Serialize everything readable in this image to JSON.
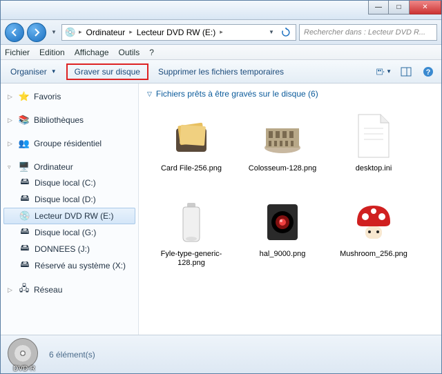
{
  "window": {
    "minimize": "—",
    "maximize": "□",
    "close": "✕"
  },
  "nav": {
    "breadcrumbs": [
      "Ordinateur",
      "Lecteur DVD RW (E:)"
    ],
    "search_placeholder": "Rechercher dans : Lecteur DVD R..."
  },
  "menu": {
    "file": "Fichier",
    "edit": "Edition",
    "view": "Affichage",
    "tools": "Outils",
    "help": "?"
  },
  "toolbar": {
    "organize": "Organiser",
    "burn": "Graver sur disque",
    "delete_temp": "Supprimer les fichiers temporaires"
  },
  "sidebar": {
    "favorites": "Favoris",
    "libraries": "Bibliothèques",
    "homegroup": "Groupe résidentiel",
    "computer": "Ordinateur",
    "drives": [
      "Disque local (C:)",
      "Disque local (D:)",
      "Lecteur DVD RW (E:)",
      "Disque local (G:)",
      "DONNEES (J:)",
      "Réservé au système (X:)"
    ],
    "network": "Réseau"
  },
  "content": {
    "header": "Fichiers prêts à être gravés sur le disque (6)",
    "files": [
      "Card File-256.png",
      "Colosseum-128.png",
      "desktop.ini",
      "Fyle-type-generic-128.png",
      "hal_9000.png",
      "Mushroom_256.png"
    ]
  },
  "status": {
    "disc_label": "DVD-R",
    "count": "6 élément(s)"
  }
}
